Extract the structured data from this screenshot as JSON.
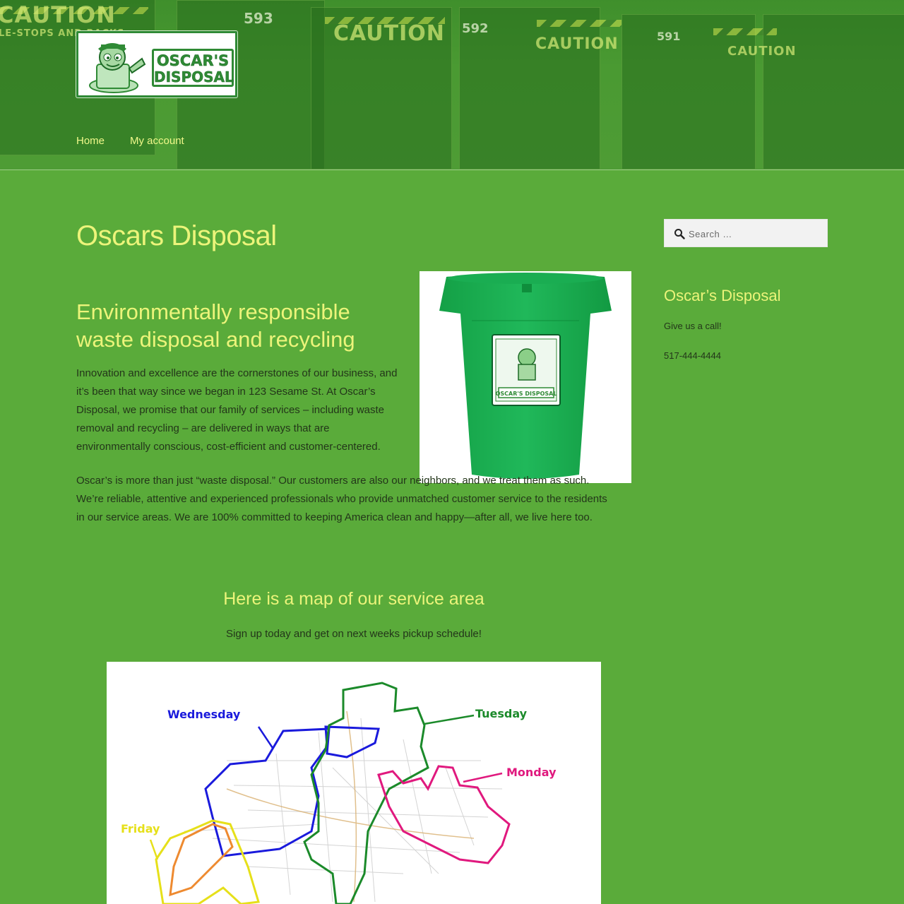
{
  "header": {
    "logo": {
      "line1": "OSCAR'S",
      "line2": "DISPOSAL"
    },
    "background_text": {
      "caution": "CAUTION",
      "numbers": [
        "593",
        "592",
        "591"
      ],
      "ribbon": "LE-STOPS AND BACKS"
    },
    "nav": [
      {
        "label": "Home"
      },
      {
        "label": "My account"
      }
    ]
  },
  "main": {
    "title": "Oscars Disposal",
    "heading": "Environmentally responsible waste disposal and recycling",
    "paragraph1": "Innovation and excellence are the cornerstones of our business, and it’s been that way since we began in 123 Sesame St. At Oscar’s Disposal, we promise that our family of services – including waste removal and recycling – are delivered in ways that are environmentally conscious, cost-efficient and customer-centered.",
    "paragraph2": "Oscar’s is more than just “waste disposal.” Our customers are also our neighbors, and we treat them as such. We’re reliable, attentive and experienced professionals who provide unmatched customer service to the residents in our service areas. We are 100% committed to keeping America clean and happy—after all, we live here too.",
    "bin_label": "OSCAR'S DISPOSAL",
    "map_heading": "Here is a map of our service area",
    "map_subheading": "Sign up today and get on next weeks pickup schedule!",
    "map": {
      "days": [
        {
          "label": "Wednesday",
          "color": "#1a1adc"
        },
        {
          "label": "Tuesday",
          "color": "#1b8a2a"
        },
        {
          "label": "Monday",
          "color": "#e0197e"
        },
        {
          "label": "Friday",
          "color": "#e6e01a"
        }
      ]
    }
  },
  "sidebar": {
    "search_placeholder": "Search …",
    "widget_title": "Oscar’s Disposal",
    "widget_line1": "Give us a call!",
    "widget_line2": "517-444-4444"
  },
  "colors": {
    "page_background": "#5aab3a",
    "heading": "#ecf47a",
    "body_text": "#23361a",
    "brand_green": "#2f8a35"
  }
}
